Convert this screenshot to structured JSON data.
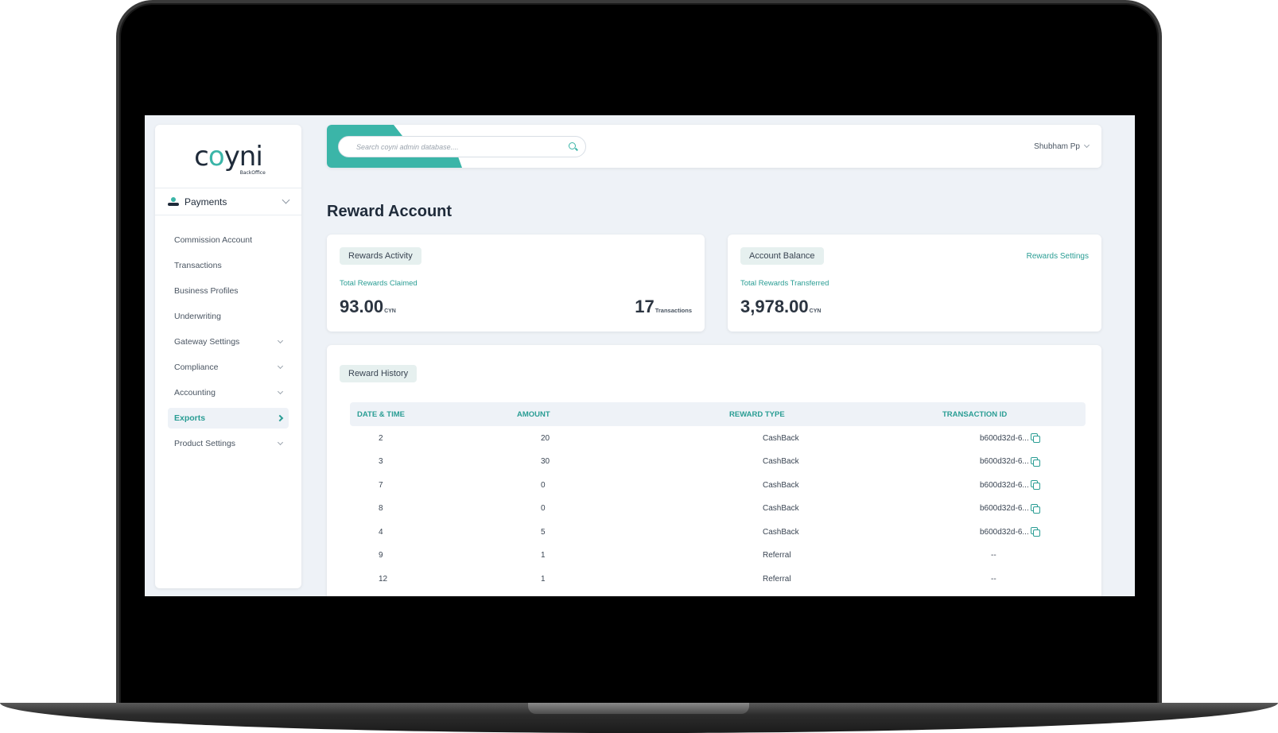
{
  "app": {
    "logo_text_main": "c",
    "logo_text_accent": "o",
    "logo_text_rest": "yni",
    "logo_sub": "BackOffice"
  },
  "sidebar": {
    "section_title": "Payments",
    "items": [
      {
        "label": "Commission Account",
        "has_chevron": false,
        "active": false
      },
      {
        "label": "Transactions",
        "has_chevron": false,
        "active": false
      },
      {
        "label": "Business Profiles",
        "has_chevron": false,
        "active": false
      },
      {
        "label": "Underwriting",
        "has_chevron": false,
        "active": false
      },
      {
        "label": "Gateway Settings",
        "has_chevron": true,
        "active": false
      },
      {
        "label": "Compliance",
        "has_chevron": true,
        "active": false
      },
      {
        "label": "Accounting",
        "has_chevron": true,
        "active": false
      },
      {
        "label": "Exports",
        "has_chevron": true,
        "active": true
      },
      {
        "label": "Product Settings",
        "has_chevron": true,
        "active": false
      }
    ]
  },
  "header": {
    "search_placeholder": "Search coyni admin database....",
    "user_name": "Shubham Pp"
  },
  "page": {
    "title": "Reward Account"
  },
  "rewards_activity": {
    "chip": "Rewards Activity",
    "label": "Total Rewards Claimed",
    "value": "93.00",
    "unit": "CYN",
    "txn_count": "17",
    "txn_unit": "Transactions"
  },
  "account_balance": {
    "chip": "Account Balance",
    "settings_link": "Rewards Settings",
    "label": "Total Rewards Transferred",
    "value": "3,978.00",
    "unit": "CYN"
  },
  "history": {
    "chip": "Reward History",
    "columns": [
      "DATE & TIME",
      "AMOUNT",
      "REWARD TYPE",
      "TRANSACTION ID"
    ],
    "rows": [
      {
        "date": "2",
        "amount": "20",
        "type": "CashBack",
        "txn": "b600d32d-6...",
        "copy": true
      },
      {
        "date": "3",
        "amount": "30",
        "type": "CashBack",
        "txn": "b600d32d-6...",
        "copy": true
      },
      {
        "date": "7",
        "amount": "0",
        "type": "CashBack",
        "txn": "b600d32d-6...",
        "copy": true
      },
      {
        "date": "8",
        "amount": "0",
        "type": "CashBack",
        "txn": "b600d32d-6...",
        "copy": true
      },
      {
        "date": "4",
        "amount": "5",
        "type": "CashBack",
        "txn": "b600d32d-6...",
        "copy": true
      },
      {
        "date": "9",
        "amount": "1",
        "type": "Referral",
        "txn": "--",
        "copy": false
      },
      {
        "date": "12",
        "amount": "1",
        "type": "Referral",
        "txn": "--",
        "copy": false
      }
    ]
  },
  "colors": {
    "accent": "#3bb5a8",
    "accent_text": "#2a9d94",
    "background": "#eef2f7",
    "text_dark": "#1f2b3a"
  }
}
